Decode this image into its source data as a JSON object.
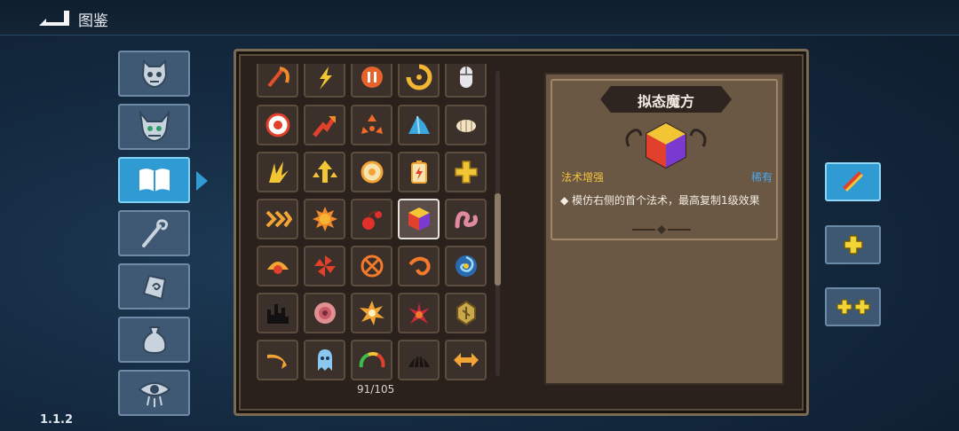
{
  "header": {
    "title": "图鉴",
    "back_icon": "back-arrow-icon"
  },
  "version": "1.1.2",
  "categories": [
    {
      "name": "monsters",
      "icon": "demon-face-icon",
      "active": false
    },
    {
      "name": "bosses",
      "icon": "horned-demon-icon",
      "active": false
    },
    {
      "name": "spell-book",
      "icon": "open-book-icon",
      "active": true
    },
    {
      "name": "staffs",
      "icon": "staff-icon",
      "active": false
    },
    {
      "name": "relics",
      "icon": "scroll-hand-icon",
      "active": false
    },
    {
      "name": "potions",
      "icon": "pouch-icon",
      "active": false
    },
    {
      "name": "curses",
      "icon": "eye-icon",
      "active": false
    }
  ],
  "grid": {
    "counter": "91/105",
    "rows": [
      [
        "scythe-icon",
        "lightning-icon",
        "pause-icon",
        "swirl-icon",
        "mouse-icon"
      ],
      [
        "target-icon",
        "red-arrow-icon",
        "triple-arrow-icon",
        "crystal-icon",
        "grub-icon"
      ],
      [
        "claw-icon",
        "arrows-up-icon",
        "gear-icon",
        "battery-icon",
        "cross-icon"
      ],
      [
        "chevrons-icon",
        "sun-icon",
        "cherry-icon",
        "prism-cube-icon",
        "worm-icon"
      ],
      [
        "shell-icon",
        "pinwheel-icon",
        "shuriken-icon",
        "hook-icon",
        "vortex-icon"
      ],
      [
        "shadow-castle-icon",
        "rose-icon",
        "explosion-icon",
        "spiky-flower-icon",
        "rune-stone-icon"
      ],
      [
        "boomerang-icon",
        "ghost-icon",
        "gauge-icon",
        "shell-dark-icon",
        "double-arrow-icon"
      ]
    ],
    "selected": "prism-cube-icon"
  },
  "detail": {
    "title": "拟态魔方",
    "icon": "prism-cube-icon",
    "type": "法术增强",
    "rarity": "稀有",
    "description": "◆ 模仿右侧的首个法术，最高复制1级效果"
  },
  "side_buttons": [
    {
      "icon": "swap-icon",
      "active": true
    },
    {
      "icon": "plus-icon",
      "active": false
    },
    {
      "icon": "double-plus-icon",
      "active": false
    }
  ],
  "colors": {
    "accent_blue": "#2f9bd2",
    "gold": "#f0c340",
    "rarity_blue": "#4aa8ee",
    "panel_brown": "#6b5844"
  }
}
